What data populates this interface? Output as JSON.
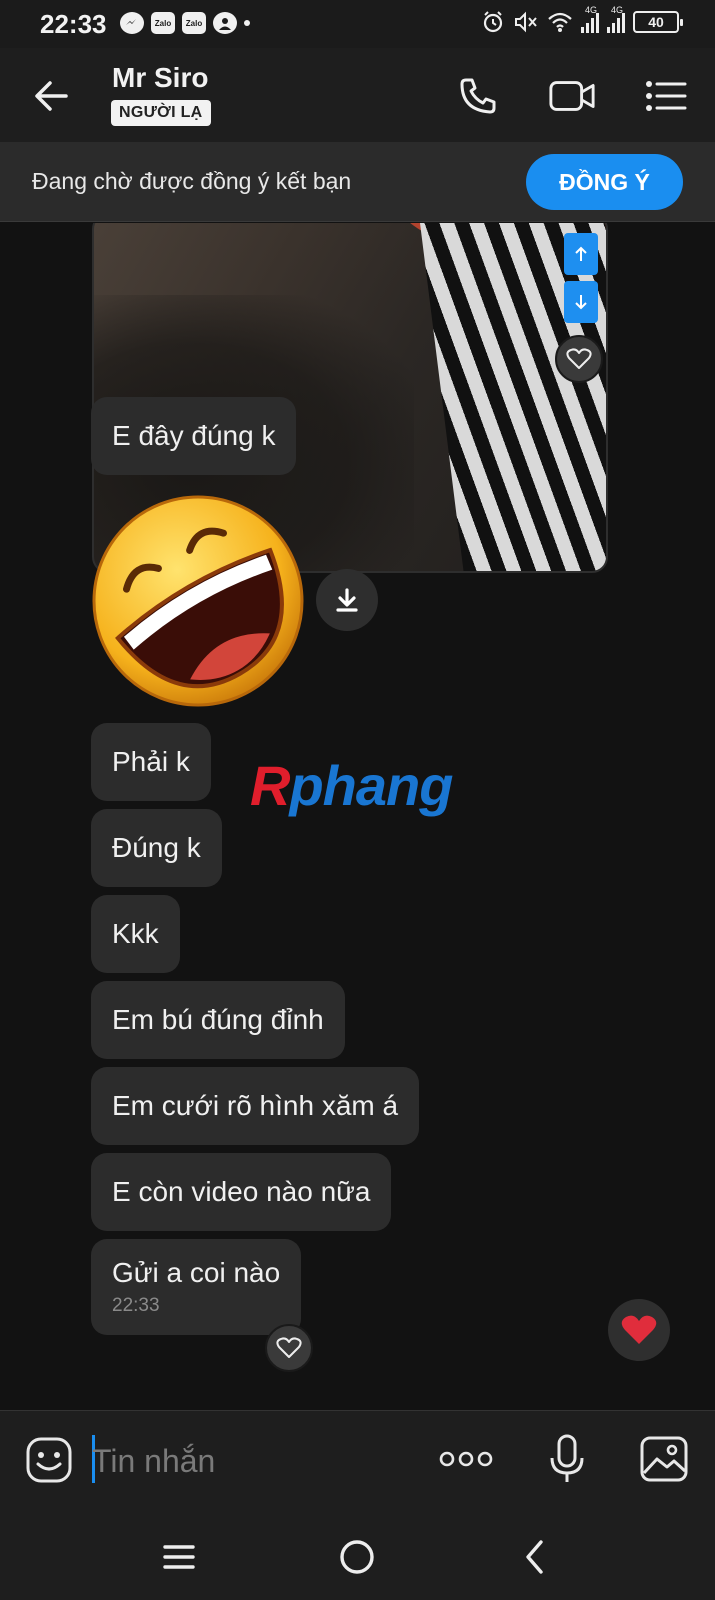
{
  "status_bar": {
    "time": "22:33",
    "left_icons": [
      "messenger-icon",
      "zalo-icon",
      "zalo-icon",
      "contact-icon",
      "dot-icon"
    ],
    "zalo_label_1": "Zalo",
    "zalo_label_2": "Zalo",
    "net_label_1": "4G",
    "net_label_2": "4G",
    "battery": "40"
  },
  "header": {
    "contact_name": "Mr Siro",
    "badge": "NGƯỜI LẠ",
    "icons": [
      "back-arrow-icon",
      "phone-icon",
      "video-call-icon",
      "menu-icon"
    ]
  },
  "friend_banner": {
    "text": "Đang chờ được đồng ý kết bạn",
    "accept_label": "ĐỒNG Ý"
  },
  "messages": [
    {
      "text": "E đây đúng k"
    },
    {
      "text": "Phải k"
    },
    {
      "text": "Đúng k"
    },
    {
      "text": "Kkk"
    },
    {
      "text": "Em bú đúng đỉnh"
    },
    {
      "text": "Em cưới rõ hình xăm á"
    },
    {
      "text": "E còn video nào nữa"
    },
    {
      "text": "Gửi a coi nào",
      "time": "22:33"
    }
  ],
  "watermark": {
    "part1": "R",
    "part2": "phang"
  },
  "composer": {
    "placeholder": "Tin nhắn",
    "icons": [
      "emoji-icon",
      "more-icon",
      "microphone-icon",
      "image-icon"
    ]
  },
  "navbar": {
    "icons": [
      "recent-apps-icon",
      "home-icon",
      "back-icon"
    ]
  },
  "colors": {
    "accent": "#1a8ef0",
    "background": "#121212",
    "bubble": "#2c2c2c",
    "heart": "#e02d3c"
  }
}
